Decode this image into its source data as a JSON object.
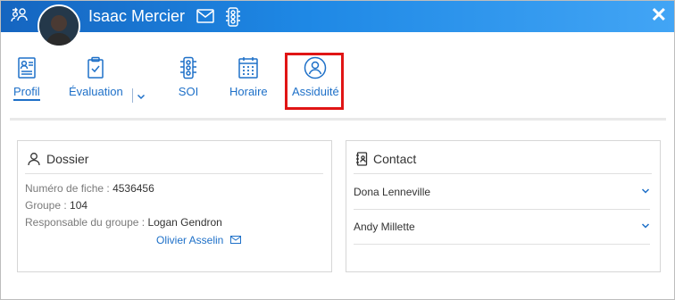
{
  "header": {
    "name": "Isaac Mercier",
    "close_label": "✕"
  },
  "tabs": [
    {
      "label": "Profil",
      "icon": "profile-card-icon"
    },
    {
      "label": "Évaluation",
      "icon": "clipboard-check-icon"
    },
    {
      "label": "SOI",
      "icon": "traffic-light-icon"
    },
    {
      "label": "Horaire",
      "icon": "calendar-grid-icon"
    },
    {
      "label": "Assiduité",
      "icon": "person-circle-icon"
    }
  ],
  "dossier": {
    "title": "Dossier",
    "numero_label": "Numéro de fiche :",
    "numero_value": "4536456",
    "groupe_label": "Groupe :",
    "groupe_value": "104",
    "responsable_label": "Responsable du groupe :",
    "responsable_value": "Logan Gendron",
    "second_contact": "Olivier Asselin"
  },
  "contact": {
    "title": "Contact",
    "people": [
      "Dona Lenneville",
      "Andy Millette"
    ]
  },
  "colors": {
    "accent": "#1e70c8",
    "header_start": "#1565c0",
    "header_end": "#42a5f5",
    "highlight": "#e01515"
  }
}
